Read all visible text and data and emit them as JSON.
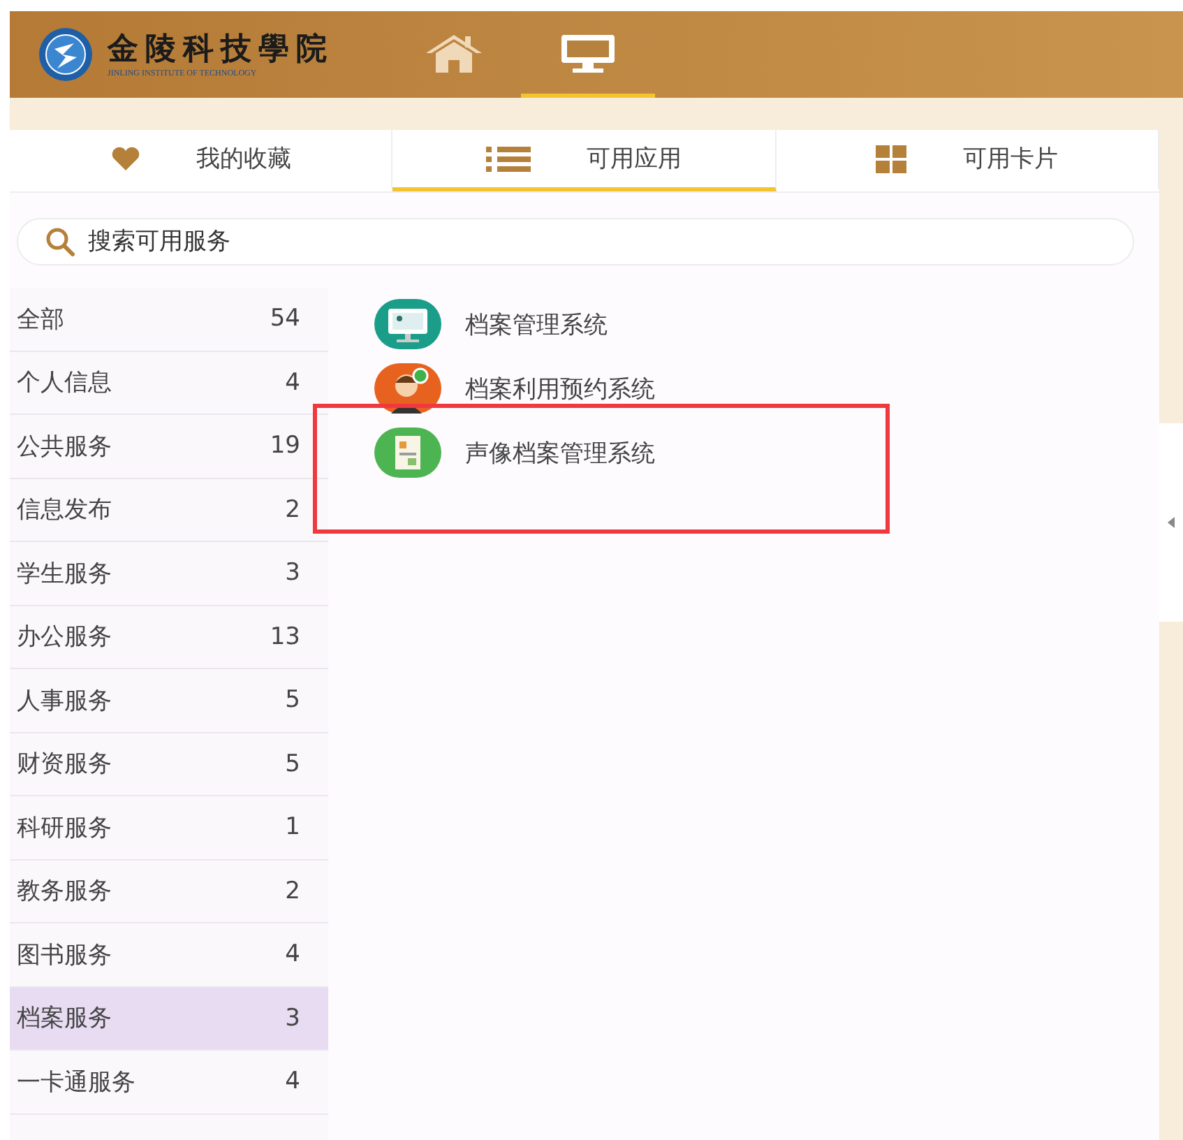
{
  "header": {
    "logo_title": "金陵科技學院",
    "logo_subtitle": "JINLING INSTITUTE OF TECHNOLOGY",
    "nav": [
      {
        "kind": "home",
        "selected": false
      },
      {
        "kind": "desktop",
        "selected": true
      }
    ]
  },
  "tabs": [
    {
      "label": "我的收藏",
      "kind": "favorites",
      "selected": false
    },
    {
      "label": "可用应用",
      "kind": "apps",
      "selected": true
    },
    {
      "label": "可用卡片",
      "kind": "cards",
      "selected": false
    }
  ],
  "search": {
    "placeholder": "搜索可用服务"
  },
  "categories": [
    {
      "name": "全部",
      "count": "54",
      "selected": false
    },
    {
      "name": "个人信息",
      "count": "4",
      "selected": false
    },
    {
      "name": "公共服务",
      "count": "19",
      "selected": false
    },
    {
      "name": "信息发布",
      "count": "2",
      "selected": false
    },
    {
      "name": "学生服务",
      "count": "3",
      "selected": false
    },
    {
      "name": "办公服务",
      "count": "13",
      "selected": false
    },
    {
      "name": "人事服务",
      "count": "5",
      "selected": false
    },
    {
      "name": "财资服务",
      "count": "5",
      "selected": false
    },
    {
      "name": "科研服务",
      "count": "1",
      "selected": false
    },
    {
      "name": "教务服务",
      "count": "2",
      "selected": false
    },
    {
      "name": "图书服务",
      "count": "4",
      "selected": false
    },
    {
      "name": "档案服务",
      "count": "3",
      "selected": true
    },
    {
      "name": "一卡通服务",
      "count": "4",
      "selected": false
    }
  ],
  "apps": [
    {
      "name": "档案管理系统",
      "kind": "monitor",
      "highlighted": false
    },
    {
      "name": "档案利用预约系统",
      "kind": "person",
      "highlighted": false
    },
    {
      "name": "声像档案管理系统",
      "kind": "document",
      "highlighted": true
    }
  ]
}
